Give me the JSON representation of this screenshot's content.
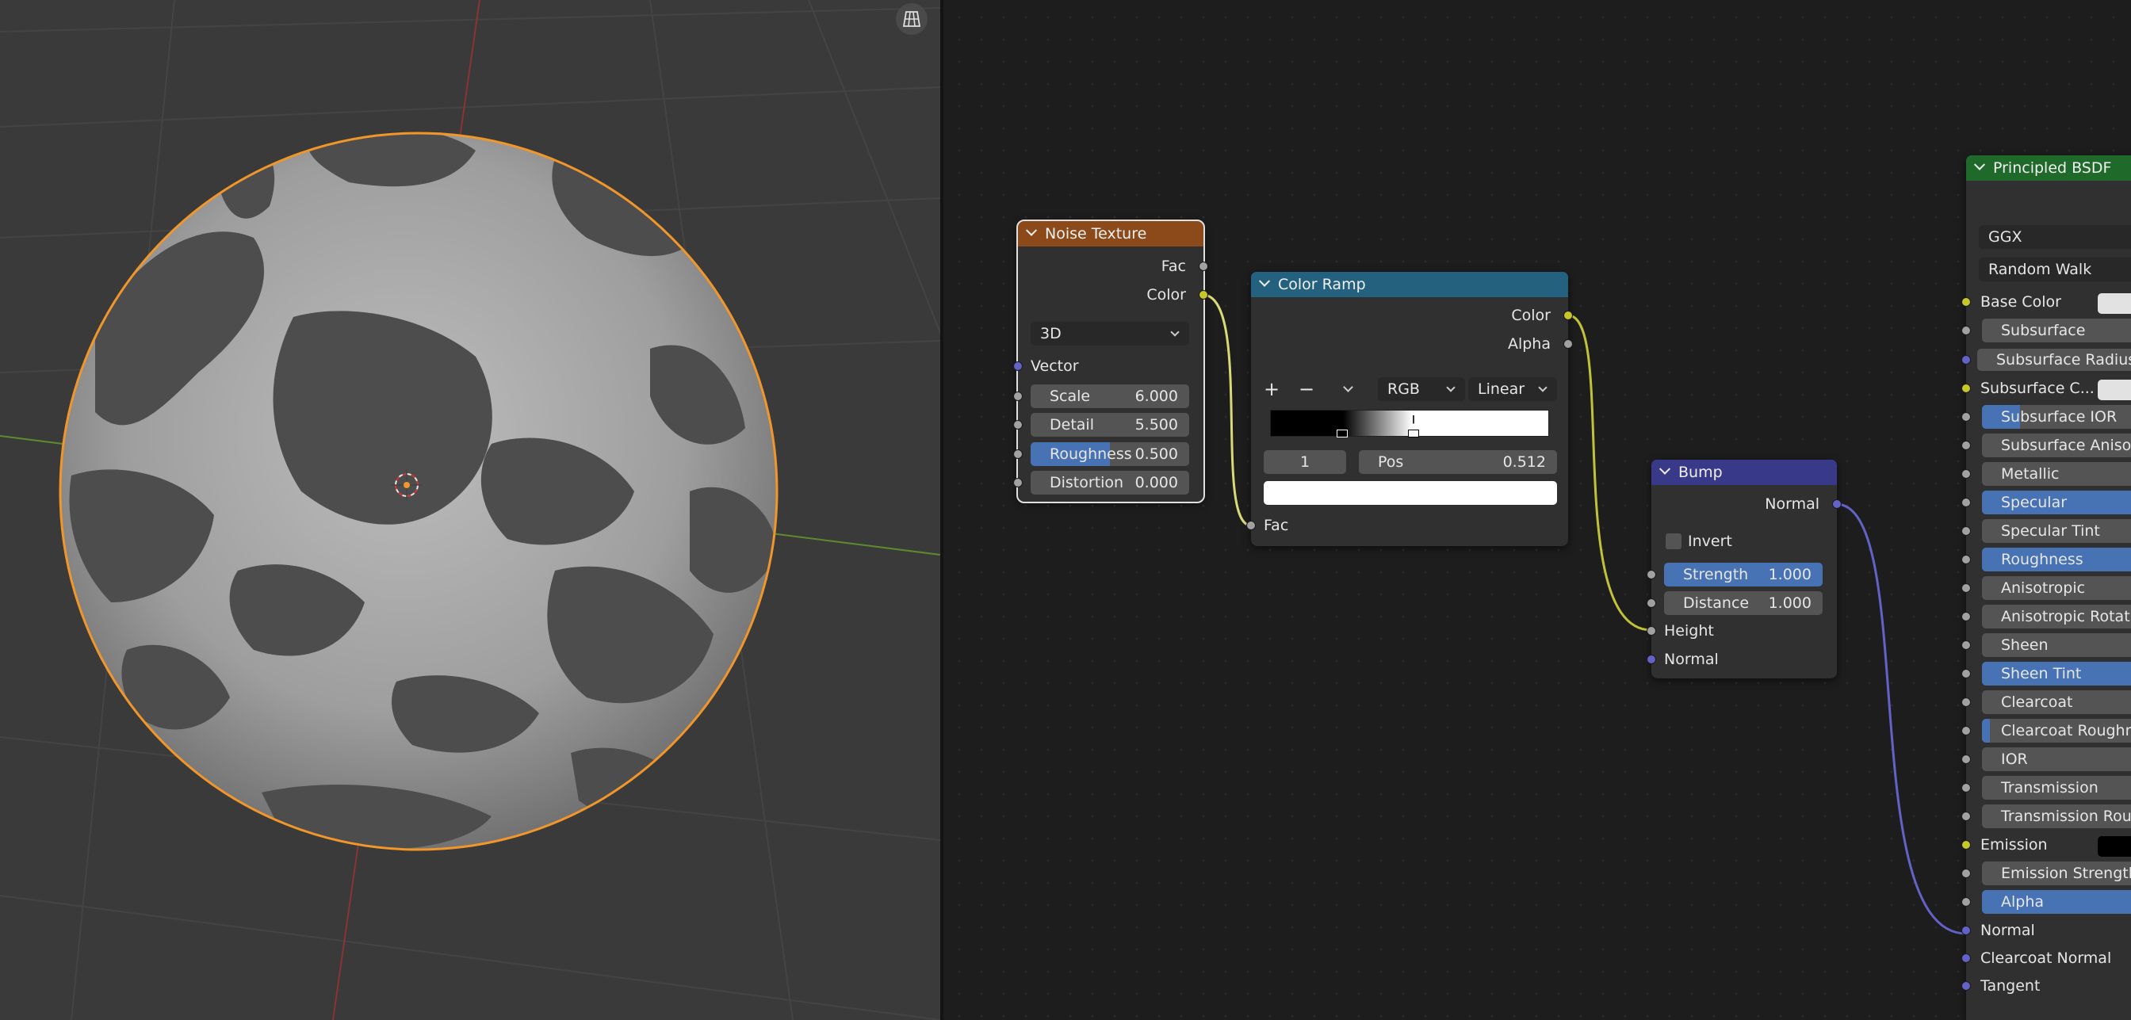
{
  "viewport": {
    "nav_icon": "grid-view-icon"
  },
  "noise_texture": {
    "title": "Noise Texture",
    "header_color": "#8c4a1b",
    "outputs": [
      "Fac",
      "Color"
    ],
    "dimension": "3D",
    "vector_label": "Vector",
    "fields": [
      {
        "label": "Scale",
        "value": "6.000"
      },
      {
        "label": "Detail",
        "value": "5.500"
      },
      {
        "label": "Roughness",
        "value": "0.500",
        "fill": 0.5
      },
      {
        "label": "Distortion",
        "value": "0.000"
      }
    ]
  },
  "color_ramp": {
    "title": "Color Ramp",
    "header_color": "#24617f",
    "outputs": [
      "Color",
      "Alpha"
    ],
    "add_label": "+",
    "remove_label": "−",
    "color_mode": "RGB",
    "interpolation": "Linear",
    "stop_index": "1",
    "pos_label": "Pos",
    "pos_value": "0.512",
    "input_label": "Fac"
  },
  "bump": {
    "title": "Bump",
    "header_color": "#39398a",
    "output": "Normal",
    "invert_label": "Invert",
    "fields": [
      {
        "label": "Strength",
        "value": "1.000"
      },
      {
        "label": "Distance",
        "value": "1.000"
      }
    ],
    "inputs": [
      "Height",
      "Normal"
    ]
  },
  "principled": {
    "title": "Principled BSDF",
    "header_color": "#1f6a2b",
    "distribution": "GGX",
    "subsurface_method": "Random Walk",
    "rows": [
      {
        "label": "Base Color",
        "kind": "color"
      },
      {
        "label": "Subsurface",
        "kind": "field"
      },
      {
        "label": "Subsurface Radius",
        "kind": "plain"
      },
      {
        "label": "Subsurface C...",
        "kind": "color"
      },
      {
        "label": "Subsurface IOR",
        "kind": "partial"
      },
      {
        "label": "Subsurface Anisotropy",
        "kind": "field"
      },
      {
        "label": "Metallic",
        "kind": "field"
      },
      {
        "label": "Specular",
        "kind": "blue"
      },
      {
        "label": "Specular Tint",
        "kind": "field"
      },
      {
        "label": "Roughness",
        "kind": "blue"
      },
      {
        "label": "Anisotropic",
        "kind": "field"
      },
      {
        "label": "Anisotropic Rotation",
        "kind": "field"
      },
      {
        "label": "Sheen",
        "kind": "field"
      },
      {
        "label": "Sheen Tint",
        "kind": "blue"
      },
      {
        "label": "Clearcoat",
        "kind": "field"
      },
      {
        "label": "Clearcoat Roughness",
        "kind": "sliver"
      },
      {
        "label": "IOR",
        "kind": "field"
      },
      {
        "label": "Transmission",
        "kind": "field"
      },
      {
        "label": "Transmission Roughness",
        "kind": "field"
      },
      {
        "label": "Emission",
        "kind": "black"
      },
      {
        "label": "Emission Strength",
        "kind": "field"
      },
      {
        "label": "Alpha",
        "kind": "blue"
      },
      {
        "label": "Normal",
        "kind": "socket"
      },
      {
        "label": "Clearcoat Normal",
        "kind": "socket"
      },
      {
        "label": "Tangent",
        "kind": "socket"
      }
    ]
  }
}
